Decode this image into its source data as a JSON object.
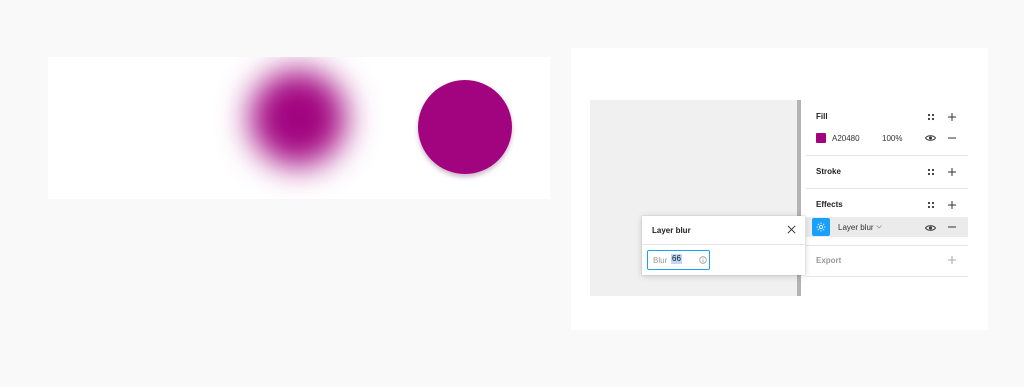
{
  "demo": {
    "circle_color": "#A20480"
  },
  "panel": {
    "fill": {
      "title": "Fill",
      "hex": "A20480",
      "opacity": "100%",
      "swatch_color": "#A20480"
    },
    "stroke": {
      "title": "Stroke"
    },
    "effects": {
      "title": "Effects",
      "effect_type": "Layer blur"
    },
    "export": {
      "title": "Export"
    }
  },
  "popup": {
    "title": "Layer blur",
    "input_label": "Blur",
    "input_value": "66"
  },
  "colors": {
    "accent": "#18A0FB",
    "brand_fill": "#A20480"
  },
  "icons": [
    "grid-dots-icon",
    "plus-icon",
    "minus-icon",
    "eye-icon",
    "close-icon",
    "sun-icon",
    "chevron-down-icon",
    "info-icon"
  ]
}
